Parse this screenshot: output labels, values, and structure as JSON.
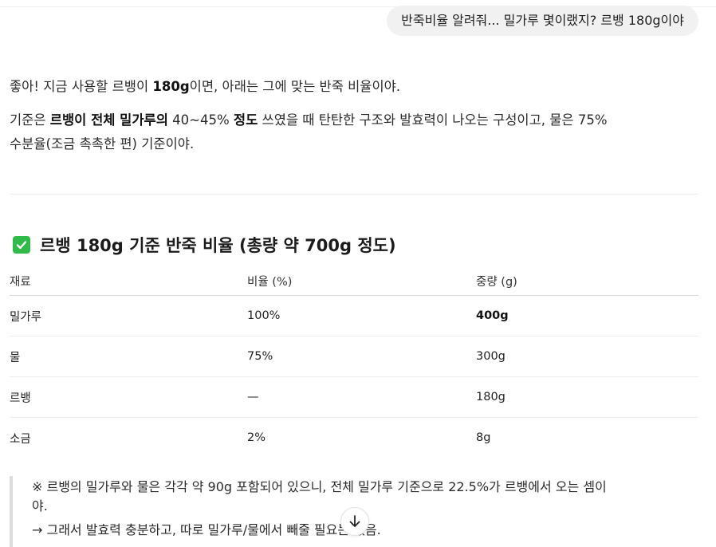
{
  "user_message": {
    "text": "반죽비율 알려줘... 밀가루 몇이랬지? 르뱅 180g이야"
  },
  "assistant": {
    "intro": {
      "part1": "좋아! 지금 사용할 르뱅이 ",
      "bold": "180g",
      "part2": "이면, 아래는 그에 맞는 반죽 비율이야."
    },
    "basis": {
      "part1": "기준은 ",
      "bold1": "르뱅이 전체 밀가루의",
      "part2": " 40~45% ",
      "bold2": "정도",
      "part3": " 쓰였을 때 탄탄한 구조와 발효력이 나오는 구성이고, 물은 75%",
      "line2": "수분율(조금 촉촉한 편) 기준이야."
    },
    "section": {
      "heading": "르뱅 180g 기준 반죽 비율 (총량 약 700g 정도)",
      "icon": "check-mark-icon",
      "icon_color": "#2fba49"
    },
    "table": {
      "headers": [
        "재료",
        "비율 (%)",
        "중량 (g)"
      ],
      "rows": [
        {
          "ingredient": "밀가루",
          "ratio": "100%",
          "weight": "400g"
        },
        {
          "ingredient": "물",
          "ratio": "75%",
          "weight": "300g"
        },
        {
          "ingredient": "르뱅",
          "ratio": "—",
          "weight": "180g"
        },
        {
          "ingredient": "소금",
          "ratio": "2%",
          "weight": "8g"
        }
      ]
    },
    "note": {
      "line1": "※ 르뱅의 밀가루와 물은 각각 약 90g 포함되어 있으니, 전체 밀가루 기준으로 22.5%가 르뱅에서 오는 셈이",
      "line2": "야.",
      "line3": "→ 그래서 발효력 충분하고, 따로 밀가루/물에서 빼줄 필요는 없음."
    }
  },
  "controls": {
    "scroll_down_icon": "arrow-down-icon"
  }
}
